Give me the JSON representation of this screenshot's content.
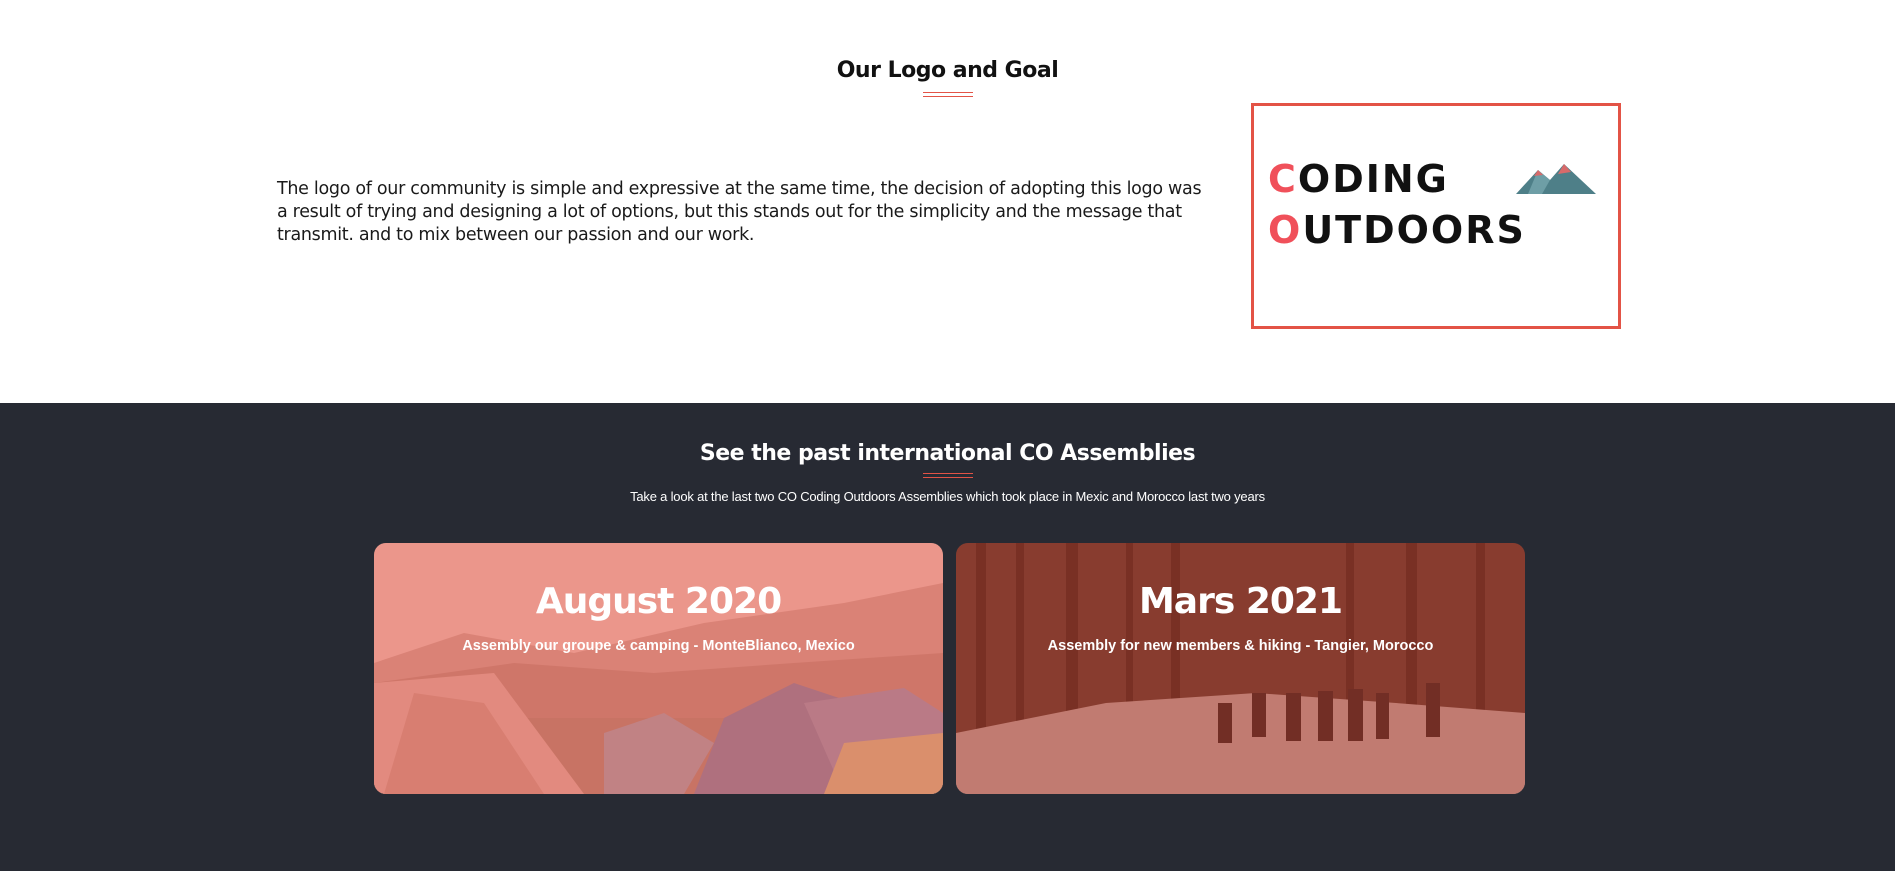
{
  "logo_section": {
    "title": "Our Logo and Goal",
    "text": "The logo of our community is simple and expressive at the same time, the decision of adopting this logo was a result of trying and designing a lot of options, but this stands out for the simplicity and the message that transmit. and to mix between our passion and our work.",
    "logo": {
      "line1_initial": "C",
      "line1_rest": "ODING",
      "line2_initial": "O",
      "line2_rest": "UTDOORS",
      "accent_color": "#f0505a",
      "frame_color": "#e35346"
    }
  },
  "assemblies": {
    "title": "See the past international CO Assemblies",
    "subtitle": "Take a look at the last two CO Coding Outdoors Assemblies which took place in Mexic and Morocco last two years",
    "cards": [
      {
        "title": "August 2020",
        "subtitle": "Assembly our groupe & camping - MonteBlianco, Mexico"
      },
      {
        "title": "Mars 2021",
        "subtitle": "Assembly for new members & hiking - Tangier, Morocco"
      }
    ]
  },
  "colors": {
    "accent": "#e35346",
    "dark_bg": "#272a33"
  }
}
